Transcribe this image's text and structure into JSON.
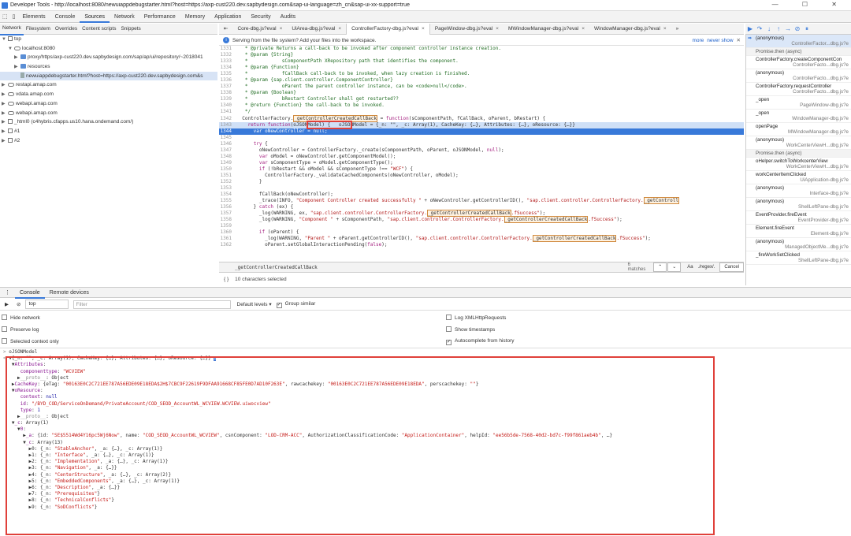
{
  "window": {
    "title": "Developer Tools - http://localhost:8080/newuiappdebugstarter.html?host=https://axp-cust220.dev.sapbydesign.com&sap-ui-language=zh_cn&sap-ui-xx-support=true",
    "controls": "—  ☐  ✕"
  },
  "main_tabs": [
    "Elements",
    "Console",
    "Sources",
    "Network",
    "Performance",
    "Memory",
    "Application",
    "Security",
    "Audits"
  ],
  "main_tab_active": "Sources",
  "source_tabs": [
    "Network",
    "Filesystem",
    "Overrides",
    "Content scripts",
    "Snippets"
  ],
  "tree": [
    {
      "label": "top",
      "indent": 0,
      "icon": "frame",
      "arrow": "▼"
    },
    {
      "label": "localhost:8080",
      "indent": 1,
      "icon": "cloud",
      "arrow": "▼"
    },
    {
      "label": "proxy/https/axp-cust220.dev.sapbydesign.com/sap/ap/ui/repository/~2018041",
      "indent": 2,
      "icon": "folder",
      "arrow": "▶"
    },
    {
      "label": "resources",
      "indent": 2,
      "icon": "folder",
      "arrow": "▶"
    },
    {
      "label": "newuiappdebugstarter.html?host=https://axp-cust220.dev.sapbydesign.com&s",
      "indent": 2,
      "icon": "file",
      "arrow": "",
      "selected": true
    },
    {
      "label": "restapi.amap.com",
      "indent": 0,
      "icon": "cloud",
      "arrow": "▶"
    },
    {
      "label": "vdata.amap.com",
      "indent": 0,
      "icon": "cloud",
      "arrow": "▶"
    },
    {
      "label": "webapi.amap.com",
      "indent": 0,
      "icon": "cloud",
      "arrow": "▶"
    },
    {
      "label": "webapi.amap.com",
      "indent": 0,
      "icon": "cloud",
      "arrow": "▶"
    },
    {
      "label": "_html0 (c4hybris.cfapps.us10.hana.ondemand.com/)",
      "indent": 0,
      "icon": "frame",
      "arrow": "▶"
    },
    {
      "label": "#1",
      "indent": 0,
      "icon": "frame",
      "arrow": "▶"
    },
    {
      "label": "#2",
      "indent": 0,
      "icon": "frame",
      "arrow": "▶"
    }
  ],
  "file_tabs": [
    {
      "label": "Core-dbg.js?eval",
      "active": false
    },
    {
      "label": "UiArea-dbg.js?eval",
      "active": false
    },
    {
      "label": "ControllerFactory-dbg.js?eval",
      "active": true
    },
    {
      "label": "PageWindow-dbg.js?eval",
      "active": false
    },
    {
      "label": "MWindowManager-dbg.js?eval",
      "active": false
    },
    {
      "label": "WindowManager-dbg.js?eval",
      "active": false
    }
  ],
  "file_tabs_more": "»",
  "infobar": {
    "text": "Serving from the file system? Add your files into the workspace.",
    "more": "more",
    "never": "never show",
    "close": "✕"
  },
  "code_lines": [
    {
      "n": "1331",
      "html": "<span class='cmt'>   * @private Returns a call-back to be invoked after component controller instance creation.</span>"
    },
    {
      "n": "1332",
      "html": "<span class='cmt'>   * @param {String}</span>"
    },
    {
      "n": "1333",
      "html": "<span class='cmt'>   *            sComponentPath XRepository path that identifies the component.</span>"
    },
    {
      "n": "1334",
      "html": "<span class='cmt'>   * @param {Function}</span>"
    },
    {
      "n": "1335",
      "html": "<span class='cmt'>   *            fCallBack call-back to be invoked, when lazy creation is finished.</span>"
    },
    {
      "n": "1336",
      "html": "<span class='cmt'>   * @param {sap.client.controller.ComponentController}</span>"
    },
    {
      "n": "1337",
      "html": "<span class='cmt'>   *            oParent the parent controller instance, can be &lt;code&gt;null&lt;/code&gt;.</span>"
    },
    {
      "n": "1338",
      "html": "<span class='cmt'>   * @param {Boolean}</span>"
    },
    {
      "n": "1339",
      "html": "<span class='cmt'>   *            bRestart Controller shall get restarted??</span>"
    },
    {
      "n": "1340",
      "html": "<span class='cmt'>   * @return {Function} the call-back to be invoked.</span>"
    },
    {
      "n": "1341",
      "html": "<span class='cmt'>   */</span>"
    },
    {
      "n": "1342",
      "html": "  ControllerFactory.<span class='mark'>_getControllerCreatedCallBack</span> = <span class='kw'>function</span>(sComponentPath, fCallBack, oParent, bRestart) {"
    },
    {
      "n": "1343",
      "html": "    <span class='kw'>return function</span>(oJSONModel) {   oJSONModel = {_n: \"\", _c: Array(1), CacheKey: {…}, Attributes: {…}, oResource: {…}}",
      "cls": "cur"
    },
    {
      "n": "1344",
      "html": "      var oNewController = null;",
      "cls": "hl"
    },
    {
      "n": "1345",
      "html": ""
    },
    {
      "n": "1346",
      "html": "      <span class='kw'>try</span> {"
    },
    {
      "n": "1347",
      "html": "        oNewController = ControllerFactory._create(sComponentPath, oParent, oJSONModel, <span class='kw'>null</span>);"
    },
    {
      "n": "1348",
      "html": "        <span class='kw'>var</span> oModel = oNewController.getComponentModel();"
    },
    {
      "n": "1349",
      "html": "        <span class='kw'>var</span> sComponentType = oModel.getComponentType();"
    },
    {
      "n": "1350",
      "html": "        <span class='kw'>if</span> (!bRestart &amp;&amp; oModel &amp;&amp; sComponentType !== <span class='str'>\"WCF\"</span>) {"
    },
    {
      "n": "1351",
      "html": "          ControllerFactory._validateCachedComponents(oNewController, oModel);"
    },
    {
      "n": "1352",
      "html": "        }"
    },
    {
      "n": "1353",
      "html": ""
    },
    {
      "n": "1354",
      "html": "        fCallBack(oNewController);"
    },
    {
      "n": "1355",
      "html": "        _trace(INFO, <span class='str'>\"Component Controller created successfully \"</span> + oNewController.getControllerID(), <span class='str'>\"sap.client.controller.ControllerFactory.</span><span class='mark'>_getControll</span>"
    },
    {
      "n": "1356",
      "html": "      } <span class='kw'>catch</span> (ex) {"
    },
    {
      "n": "1357",
      "html": "        _log(WARNING, ex, <span class='str'>\"sap.client.controller.ControllerFactory.</span><span class='mark'>_getControllerCreatedCallBack</span><span class='str'>.fSuccess\"</span>);"
    },
    {
      "n": "1358",
      "html": "        _log(WARNING, <span class='str'>\"Component \"</span> + sComponentPath, <span class='str'>\"sap.client.controller.ControllerFactory.</span><span class='mark'>_getControllerCreatedCallBack</span><span class='str'>.fSuccess\"</span>);"
    },
    {
      "n": "1359",
      "html": ""
    },
    {
      "n": "1360",
      "html": "        <span class='kw'>if</span> (oParent) {"
    },
    {
      "n": "1361",
      "html": "          _log(WARNING, <span class='str'>\"Parent \"</span> + oParent.getControllerID(), <span class='str'>\"sap.client.controller.ControllerFactory.</span><span class='mark'>_getControllerCreatedCallBack</span><span class='str'>.fSuccess\"</span>);"
    },
    {
      "n": "1362",
      "html": "          oParent.setGlobalInteractionPending(<span class='kw'>false</span>);"
    }
  ],
  "search": {
    "value": "_getControllerCreatedCallBack",
    "matches": "6 matches",
    "case": "Aa",
    "regex": "./regex/.",
    "cancel": "Cancel"
  },
  "status": "10 characters selected",
  "call_stack": [
    {
      "n": "(anonymous)",
      "f": "ControllerFactor...dbg.js?e",
      "sel": true
    },
    {
      "async": true,
      "n": "Promise.then (async)"
    },
    {
      "n": "ControllerFactory.createComponentCon",
      "f": "ControllerFacto...dbg.js?e"
    },
    {
      "n": "(anonymous)",
      "f": "ControllerFacto...dbg.js?e"
    },
    {
      "n": "ControllerFactory.requestController",
      "f": "ControllerFacto...dbg.js?e"
    },
    {
      "n": "_open",
      "f": "PageWindow-dbg.js?e"
    },
    {
      "n": "_open",
      "f": "WindowManager-dbg.js?e"
    },
    {
      "n": "openPage",
      "f": "MWindowManager-dbg.js?e"
    },
    {
      "n": "(anonymous)",
      "f": "WorkCenterViewH...dbg.js?e"
    },
    {
      "async": true,
      "n": "Promise.then (async)"
    },
    {
      "n": "oHelper.switchToWorkcenterView",
      "f": "WorkCenterViewH...dbg.js?e"
    },
    {
      "n": "workCenterItemClicked",
      "f": "UiApplication-dbg.js?e"
    },
    {
      "n": "(anonymous)",
      "f": "Interface-dbg.js?e"
    },
    {
      "n": "(anonymous)",
      "f": "ShellLeftPane-dbg.js?e"
    },
    {
      "n": "EventProvider.fireEvent",
      "f": "EventProvider-dbg.js?e"
    },
    {
      "n": "Element.fireEvent",
      "f": "Element-dbg.js?e"
    },
    {
      "n": "(anonymous)",
      "f": "ManagedObjectMe...dbg.js?e"
    },
    {
      "n": "_fireWorkSetClicked",
      "f": "ShellLeftPane-dbg.js?e"
    }
  ],
  "drawer_tabs": [
    "Console",
    "Remote devices"
  ],
  "console_toolbar": {
    "context": "top",
    "filter_placeholder": "Filter",
    "levels": "Default levels ▾",
    "group": "Group similar"
  },
  "options_left": [
    "Hide network",
    "Preserve log",
    "Selected context only"
  ],
  "options_right": [
    {
      "label": "Log XMLHttpRequests",
      "checked": false
    },
    {
      "label": "Show timestamps",
      "checked": false
    },
    {
      "label": "Autocomplete from history",
      "checked": true
    }
  ],
  "console_lines": [
    {
      "html": "<span class='gray'>&gt; </span>oJSONModel"
    },
    {
      "html": "<span class='gray'>&lt; </span>▼{_n: \"\", _c: Array(1), CacheKey: {…}, Attributes: {…}, oResource: {…}} <span style='background:#4a7ed6;color:#fff;font-size:5px'>i</span>"
    },
    {
      "html": "   ▼<span class='prop'>Attributes</span>:"
    },
    {
      "html": "      <span class='prop'>componenttype</span>: <span class='sv'>\"WCVIEW\"</span>"
    },
    {
      "html": "     ▶<span class='gray'>__proto__</span>: Object"
    },
    {
      "html": "   ▶<span class='prop'>CacheKey</span>: {eTag: <span class='sv'>\"00163E0C2C721EE787A56EDE09E18EDA$2H$7CBC9F22619F9DFAA91668CF85FE0D7AD10F263E\"</span>, rawcachekey: <span class='sv'>\"00163E0C2C721EE787A56EDE09E18EDA\"</span>, perscachekey: <span class='sv'>\"\"</span>}"
    },
    {
      "html": "   ▼<span class='prop'>oResource</span>:"
    },
    {
      "html": "      <span class='prop'>context</span>: <span class='val'>null</span>"
    },
    {
      "html": "      <span class='prop'>id</span>: <span class='sv'>\"/BYD_COD/ServiceOnDemand/PrivateAccount/COD_SEOD_AccountWL_WCVIEW.WCVIEW.uiwocview\"</span>"
    },
    {
      "html": "      <span class='prop'>type</span>: <span class='val'>1</span>"
    },
    {
      "html": "     ▶<span class='gray'>__proto__</span>: Object"
    },
    {
      "html": "   ▼<span class='prop'>_c</span>: Array(1)"
    },
    {
      "html": "     ▼<span class='prop'>0</span>:"
    },
    {
      "html": "       ▶<span class='prop'>_a</span>: {id: <span class='sv'>\"SE$5514Wd4Y16pc5Wj6Now\"</span>, name: <span class='sv'>\"COD_SEOD_AccountWL_WCVIEW\"</span>, csnComponent: <span class='sv'>\"LOD-CRM-ACC\"</span>, AuthorizationClassificationCode: <span class='sv'>\"ApplicationContainer\"</span>, helpId: <span class='sv'>\"ee56b5de-7568-40d2-bd7c-f99f861aeb4b\"</span>, …}"
    },
    {
      "html": "       ▼<span class='prop'>_c</span>: Array(13)"
    },
    {
      "html": "         ▶0: {_n: <span class='sv'>\"StableAnchor\"</span>, _a: {…}, _c: Array(1)}"
    },
    {
      "html": "         ▶1: {_n: <span class='sv'>\"Interface\"</span>, _a: {…}, _c: Array(1)}"
    },
    {
      "html": "         ▶2: {_n: <span class='sv'>\"Implementation\"</span>, _a: {…}, _c: Array(1)}"
    },
    {
      "html": "         ▶3: {_n: <span class='sv'>\"Navigation\"</span>, _a: {…}}"
    },
    {
      "html": "         ▶4: {_n: <span class='sv'>\"CenterStructure\"</span>, _a: {…}, _c: Array(2)}"
    },
    {
      "html": "         ▶5: {_n: <span class='sv'>\"EmbeddedComponents\"</span>, _a: {…}, _c: Array(1)}"
    },
    {
      "html": "         ▶6: {_n: <span class='sv'>\"Description\"</span>, _a: {…}}"
    },
    {
      "html": "         ▶7: {_n: <span class='sv'>\"Prerequisites\"</span>}"
    },
    {
      "html": "         ▶8: {_n: <span class='sv'>\"TechnicalConflicts\"</span>}"
    },
    {
      "html": "         ▶9: {_n: <span class='sv'>\"SoDConflicts\"</span>}"
    }
  ]
}
